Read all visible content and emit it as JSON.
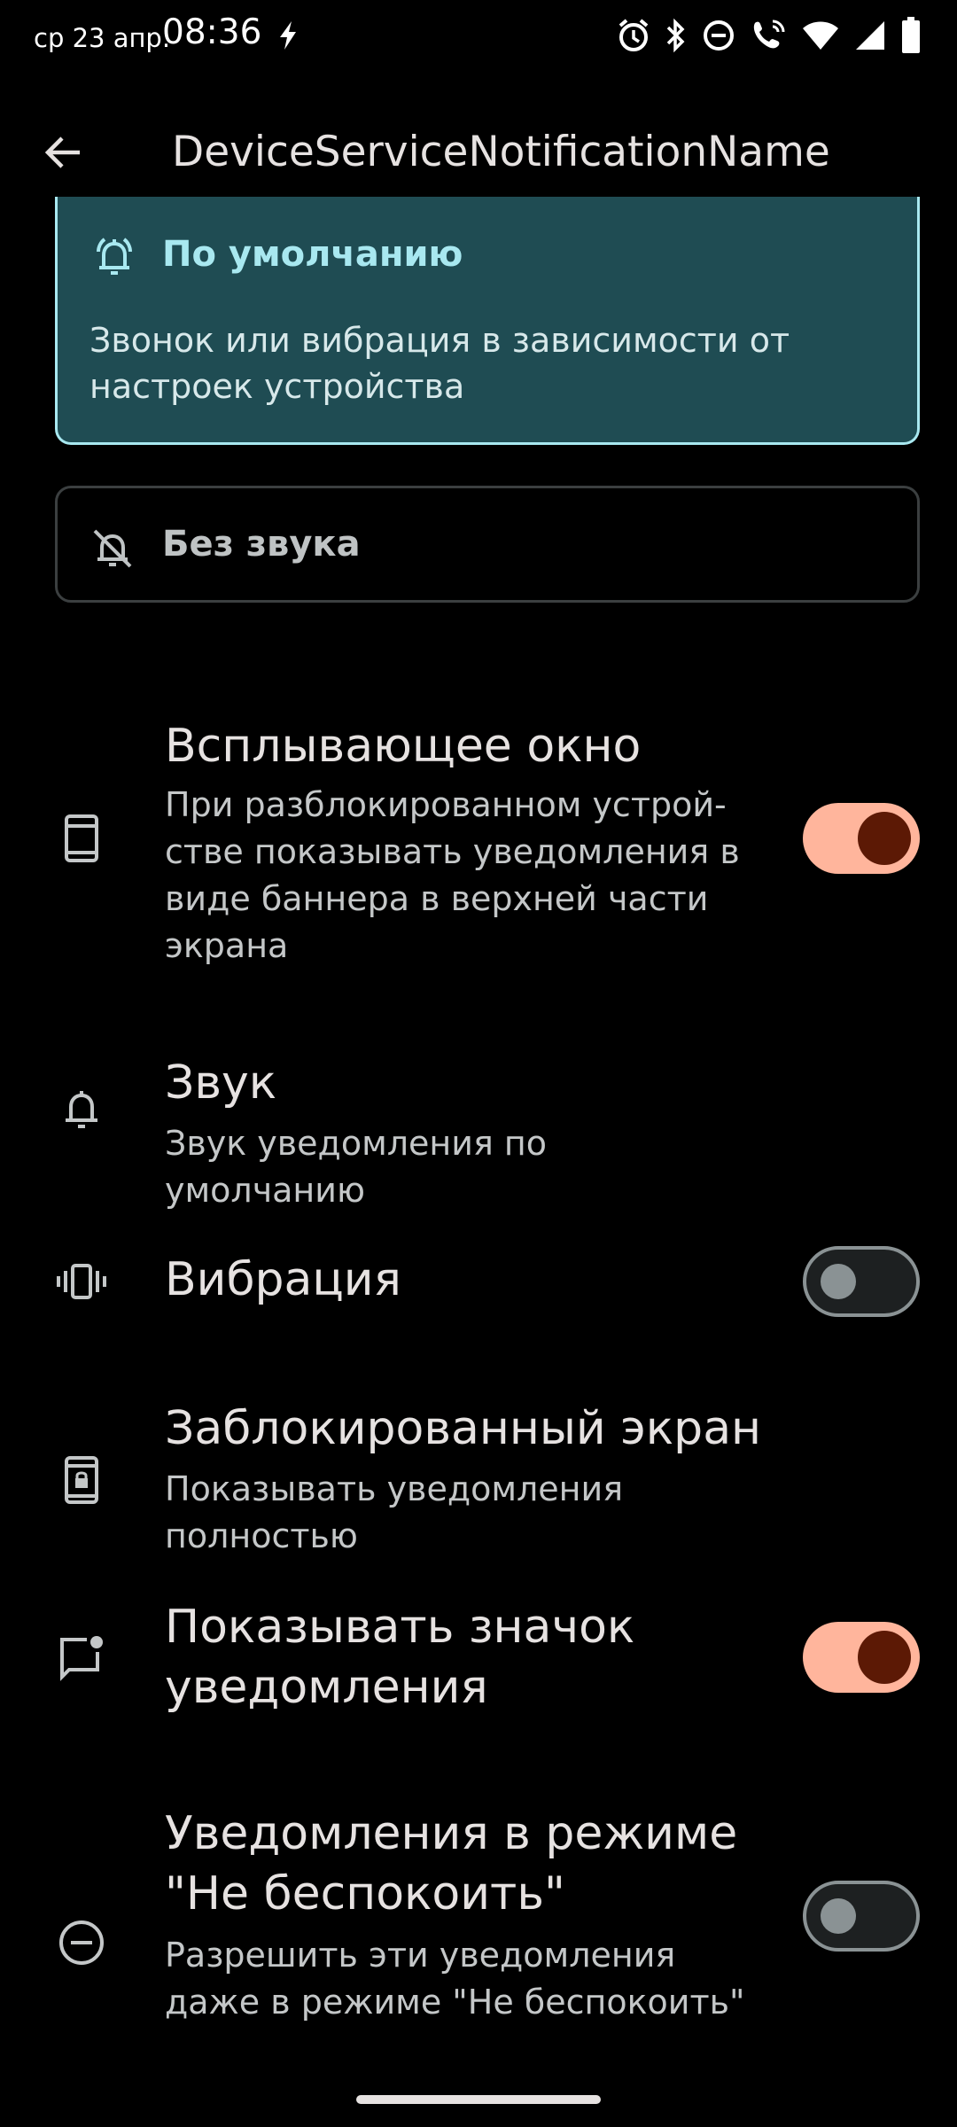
{
  "status_bar": {
    "date": "ср 23 апр.",
    "time": "08:36",
    "icons": [
      "bolt-icon",
      "alarm-icon",
      "bluetooth-icon",
      "dnd-icon",
      "wifi-calling-icon",
      "wifi-icon",
      "signal-icon",
      "battery-icon"
    ]
  },
  "app_bar": {
    "title": "DeviceServiceNotificationName",
    "back_icon": "arrow-back-icon"
  },
  "options": {
    "default": {
      "title": "По умолчанию",
      "description": "Звонок или вибрация в зависимости от настроек устройства",
      "selected": true,
      "icon": "bell-ringing-icon",
      "accent_color": "#a8e8f0"
    },
    "silent": {
      "title": "Без звука",
      "selected": false,
      "icon": "bell-off-icon"
    }
  },
  "settings": {
    "popup": {
      "title": "Всплывающее окно",
      "summary": "При разблокированном устрой-стве показывать уведомления в виде баннера в верхней части экрана",
      "enabled": true,
      "icon": "phone-popup-icon"
    },
    "sound": {
      "title": "Звук",
      "summary": "Звук уведомления по умолчанию",
      "icon": "bell-icon"
    },
    "vibration": {
      "title": "Вибрация",
      "enabled": false,
      "icon": "vibration-icon"
    },
    "lock_screen": {
      "title": "Заблокированный экран",
      "summary": "Показывать уведомления полностью",
      "icon": "phone-lock-icon"
    },
    "badge": {
      "title": "Показывать значок уведомления",
      "enabled": true,
      "icon": "badge-icon"
    },
    "dnd": {
      "title": "Уведомления в режиме \"Не беспокоить\"",
      "summary": "Разрешить эти уведомления даже в режиме \"Не беспокоить\"",
      "enabled": false,
      "icon": "dnd-circle-icon"
    }
  },
  "colors": {
    "toggle_on_track": "#ffb59c",
    "toggle_on_knob": "#5c1905",
    "toggle_off": "#8a9294",
    "selected_card_bg": "#1f4c53"
  }
}
